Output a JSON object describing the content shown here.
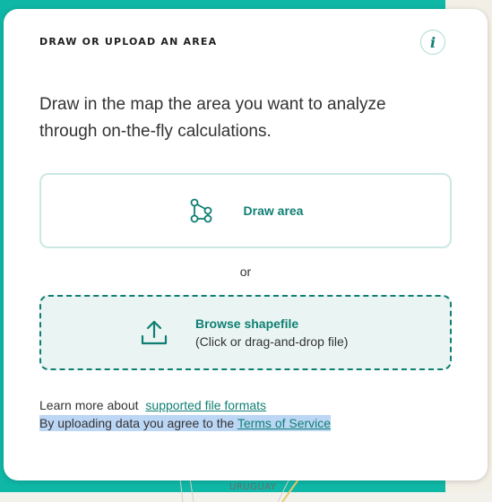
{
  "panel": {
    "title": "DRAW OR UPLOAD AN AREA",
    "info_label": "i",
    "description": "Draw in the map the area you want to analyze through on-the-fly calculations.",
    "draw_label": "Draw area",
    "or_label": "or",
    "upload_title": "Browse shapefile",
    "upload_subtitle": "(Click or drag-and-drop file)",
    "learn_prefix": "Learn more about",
    "learn_link": "supported file formats",
    "terms_prefix": "By uploading data you agree to the",
    "terms_link": "Terms of Service"
  },
  "map": {
    "label": "URUGUAY"
  },
  "colors": {
    "accent": "#0f7f73",
    "accent_light": "#cbe8e3",
    "upload_bg": "#eaf5f3",
    "map_teal": "#0fb7a6",
    "selection": "#bcd6f5"
  },
  "icons": {
    "info": "info-icon",
    "draw": "polygon-draw-icon",
    "upload": "upload-icon"
  }
}
